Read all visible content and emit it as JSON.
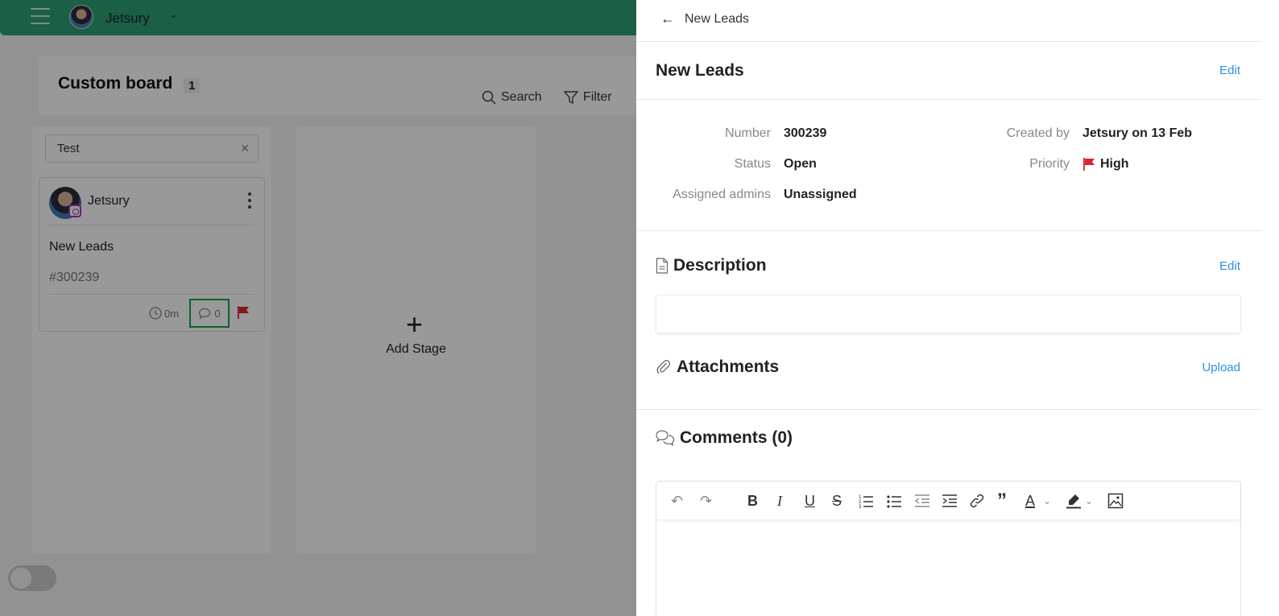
{
  "topbar": {
    "workspace_name": "Jetsury"
  },
  "board": {
    "title": "Custom board",
    "count": "1",
    "search_label": "Search",
    "filter_label": "Filter"
  },
  "column": {
    "search_value": "Test",
    "card": {
      "author": "Jetsury",
      "title": "New Leads",
      "number": "#300239",
      "time": "0m",
      "comments": "0"
    }
  },
  "add_stage": {
    "label": "Add Stage"
  },
  "drawer": {
    "header_title": "New Leads",
    "title": "New Leads",
    "edit_label": "Edit",
    "meta": {
      "number_label": "Number",
      "number_value": "300239",
      "status_label": "Status",
      "status_value": "Open",
      "assigned_label": "Assigned admins",
      "assigned_value": "Unassigned",
      "created_label": "Created by",
      "created_value": "Jetsury on 13 Feb",
      "priority_label": "Priority",
      "priority_value": "High"
    },
    "description_title": "Description",
    "description_edit": "Edit",
    "attachments_title": "Attachments",
    "upload_label": "Upload",
    "comments_title": "Comments (0)"
  },
  "colors": {
    "brand_green": "#2e9e74",
    "link_blue": "#2d8fe0",
    "flag_red": "#d9262e",
    "highlight_green": "#1aa34a"
  }
}
